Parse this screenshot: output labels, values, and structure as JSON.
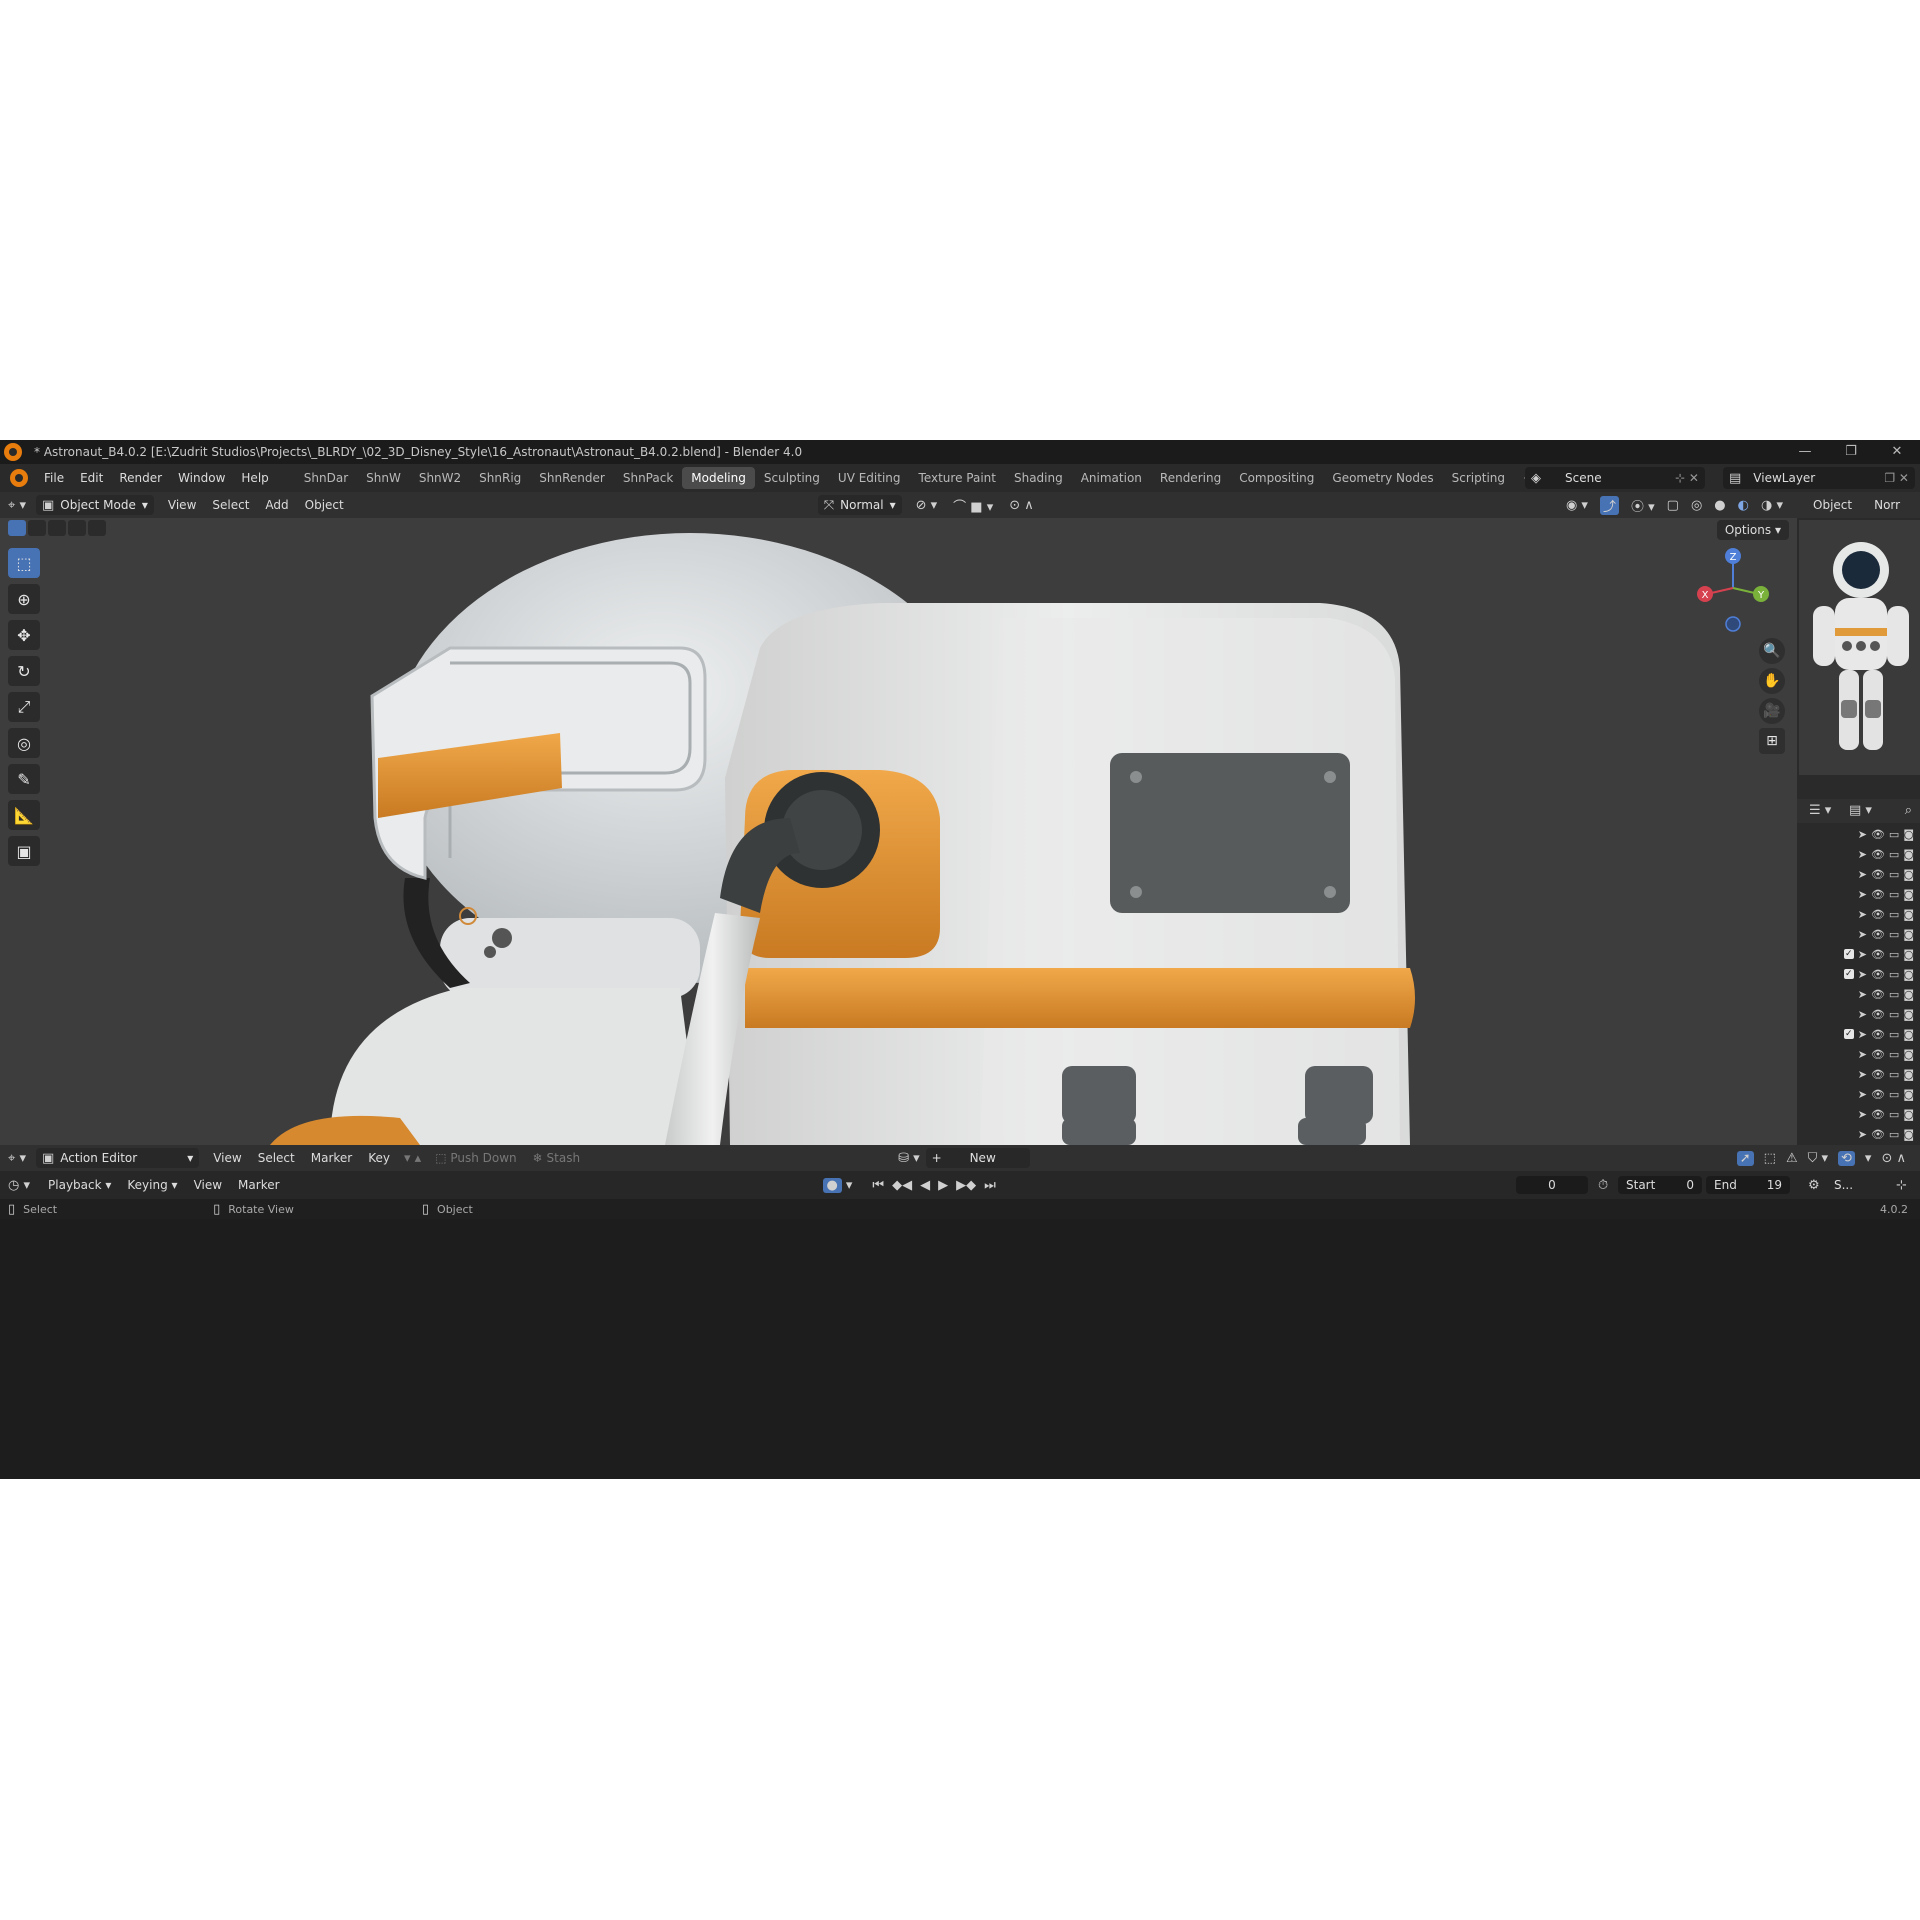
{
  "window": {
    "title": "* Astronaut_B4.0.2 [E:\\Zudrit Studios\\Projects\\_BLRDY_\\02_3D_Disney_Style\\16_Astronaut\\Astronaut_B4.0.2.blend] - Blender 4.0",
    "controls": [
      "—",
      "❐",
      "✕"
    ]
  },
  "topbar": {
    "menus": [
      "File",
      "Edit",
      "Render",
      "Window",
      "Help"
    ],
    "workspaces": [
      "ShnDar",
      "ShnW",
      "ShnW2",
      "ShnRig",
      "ShnRender",
      "ShnPack",
      "Modeling",
      "Sculpting",
      "UV Editing",
      "Texture Paint",
      "Shading",
      "Animation",
      "Rendering",
      "Compositing",
      "Geometry Nodes",
      "Scripting"
    ],
    "active_workspace": "Modeling",
    "add_tab": "+",
    "scene": "Scene",
    "view_layer": "ViewLayer"
  },
  "viewport_header": {
    "mode": "Object Mode",
    "menus": [
      "View",
      "Select",
      "Add",
      "Object"
    ],
    "orientation": "Normal",
    "options": "Options"
  },
  "gizmo": {
    "z": "Z",
    "x": "X",
    "y": "Y"
  },
  "properties": {
    "tab_object": "Object",
    "tab_normal": "Norr"
  },
  "action_editor": {
    "mode": "Action Editor",
    "menus": [
      "View",
      "Select",
      "Marker",
      "Key"
    ],
    "push_down": "Push Down",
    "stash": "Stash",
    "new": "New"
  },
  "timeline": {
    "menus": [
      "Playback",
      "Keying",
      "View",
      "Marker"
    ],
    "current_frame": "0",
    "start_label": "Start",
    "start_value": "0",
    "end_label": "End",
    "end_value": "19",
    "scene_short": "S..."
  },
  "statusbar": {
    "select": "Select",
    "rotate_view": "Rotate View",
    "object": "Object",
    "version": "4.0.2"
  },
  "outliner_rows": [
    {
      "checked": false,
      "dim": false
    },
    {
      "checked": false,
      "dim": false
    },
    {
      "checked": false,
      "dim": false
    },
    {
      "checked": false,
      "dim": false
    },
    {
      "checked": false,
      "dim": false
    },
    {
      "checked": false,
      "dim": false
    },
    {
      "checked": true,
      "dim": false
    },
    {
      "checked": true,
      "dim": false
    },
    {
      "checked": false,
      "dim": false
    },
    {
      "checked": false,
      "dim": false
    },
    {
      "checked": true,
      "dim": false
    },
    {
      "checked": false,
      "dim": false
    },
    {
      "checked": false,
      "dim": false
    },
    {
      "checked": false,
      "dim": false
    },
    {
      "checked": false,
      "dim": false
    },
    {
      "checked": false,
      "dim": false
    },
    {
      "checked": false,
      "dim": false
    },
    {
      "checked": true,
      "dim": false
    },
    {
      "checked": false,
      "dim": false
    },
    {
      "checked": true,
      "dim": false
    },
    {
      "checked": true,
      "dim": false
    },
    {
      "checked": false,
      "dim": false
    },
    {
      "checked": true,
      "dim": true
    },
    {
      "checked": false,
      "dim": true
    },
    {
      "checked": false,
      "dim": false
    }
  ],
  "colors": {
    "accent": "#4772b3",
    "suit_orange": "#e09a3a",
    "suit_white": "#e7e8e8",
    "viewport_bg": "#3d3d3d"
  }
}
